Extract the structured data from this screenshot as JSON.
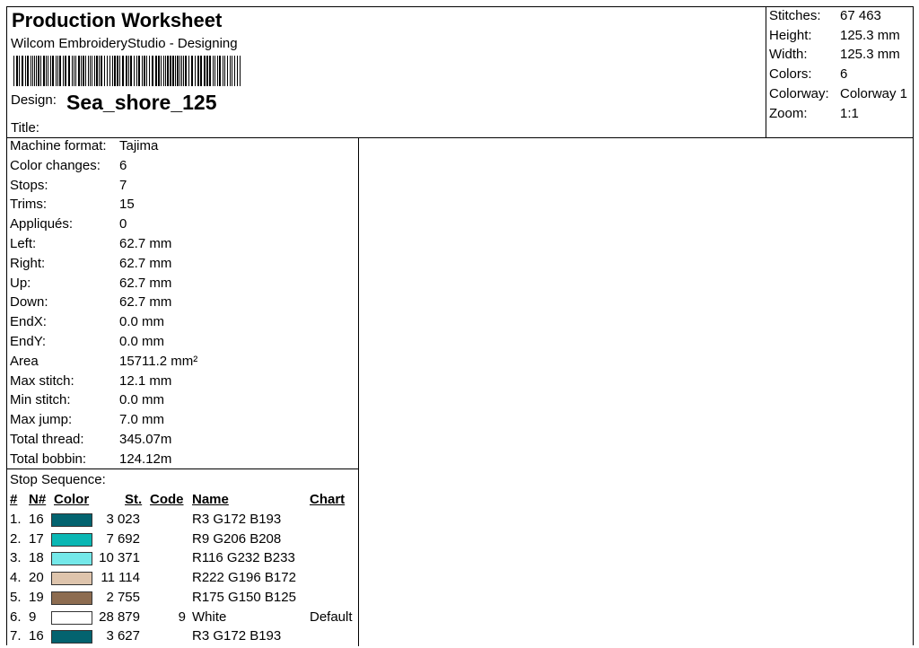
{
  "header": {
    "title": "Production Worksheet",
    "subtitle": "Wilcom EmbroideryStudio - Designing",
    "design_label": "Design:",
    "design_name": "Sea_shore_125",
    "title_label": "Title:"
  },
  "summary": [
    {
      "label": "Stitches:",
      "value": "67 463"
    },
    {
      "label": "Height:",
      "value": "125.3 mm"
    },
    {
      "label": "Width:",
      "value": "125.3 mm"
    },
    {
      "label": "Colors:",
      "value": "6"
    },
    {
      "label": "Colorway:",
      "value": "Colorway 1"
    },
    {
      "label": "Zoom:",
      "value": "1:1"
    }
  ],
  "stats": [
    {
      "label": "Machine format:",
      "value": "Tajima"
    },
    {
      "label": "Color changes:",
      "value": "6"
    },
    {
      "label": "Stops:",
      "value": "7"
    },
    {
      "label": "Trims:",
      "value": "15"
    },
    {
      "label": "Appliqués:",
      "value": "0"
    },
    {
      "label": "Left:",
      "value": "62.7 mm"
    },
    {
      "label": "Right:",
      "value": "62.7 mm"
    },
    {
      "label": "Up:",
      "value": "62.7 mm"
    },
    {
      "label": "Down:",
      "value": "62.7 mm"
    },
    {
      "label": "EndX:",
      "value": "0.0 mm"
    },
    {
      "label": "EndY:",
      "value": "0.0 mm"
    },
    {
      "label": "Area",
      "value": "15711.2 mm²"
    },
    {
      "label": "Max stitch:",
      "value": "12.1 mm"
    },
    {
      "label": "Min stitch:",
      "value": "0.0 mm"
    },
    {
      "label": "Max jump:",
      "value": "7.0 mm"
    },
    {
      "label": "Total thread:",
      "value": "345.07m"
    },
    {
      "label": "Total bobbin:",
      "value": "124.12m"
    }
  ],
  "stop_sequence": {
    "title": "Stop Sequence:",
    "headers": {
      "index": "#",
      "needle": "N#",
      "color": "Color",
      "stitches": "St.",
      "code": "Code",
      "name": "Name",
      "chart": "Chart"
    },
    "rows": [
      {
        "index": "1.",
        "needle": "16",
        "color": "#03636f",
        "stitches": "3 023",
        "code": "",
        "name": "R3 G172 B193",
        "chart": ""
      },
      {
        "index": "2.",
        "needle": "17",
        "color": "#0ab7b4",
        "stitches": "7 692",
        "code": "",
        "name": "R9 G206 B208",
        "chart": ""
      },
      {
        "index": "3.",
        "needle": "18",
        "color": "#74e8e9",
        "stitches": "10 371",
        "code": "",
        "name": "R116 G232 B233",
        "chart": ""
      },
      {
        "index": "4.",
        "needle": "20",
        "color": "#dec4ac",
        "stitches": "11 114",
        "code": "",
        "name": "R222 G196 B172",
        "chart": ""
      },
      {
        "index": "5.",
        "needle": "19",
        "color": "#8d6c50",
        "stitches": "2 755",
        "code": "",
        "name": "R175 G150 B125",
        "chart": ""
      },
      {
        "index": "6.",
        "needle": "9",
        "color": "#ffffff",
        "stitches": "28 879",
        "code": "9",
        "name": "White",
        "chart": "Default"
      },
      {
        "index": "7.",
        "needle": "16",
        "color": "#03636f",
        "stitches": "3 627",
        "code": "",
        "name": "R3 G172 B193",
        "chart": ""
      }
    ]
  }
}
